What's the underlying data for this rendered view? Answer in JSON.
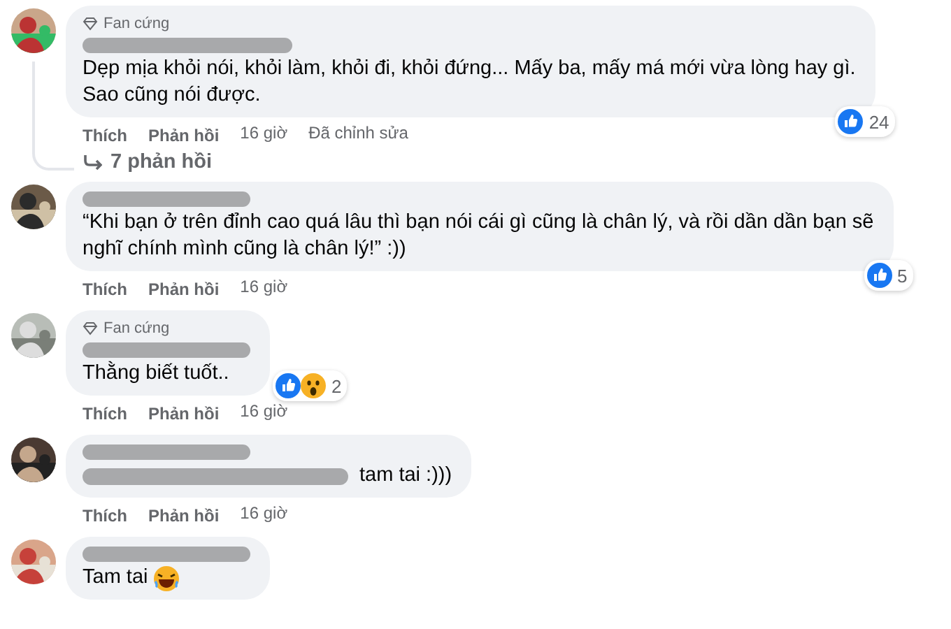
{
  "comments": [
    {
      "kind": "plain",
      "badge": "Fan cứng",
      "text": [
        "Dẹp mịa khỏi nói, khỏi làm, khỏi đi, khỏi đứng... Mấy ba, mấy má mới vừa lòng hay gì.",
        "Sao cũng nói được."
      ],
      "reactions": [
        {
          "kind": "like"
        }
      ],
      "reaction_count": "24",
      "actions": [
        "Thích",
        "Phản hồi",
        "16 giờ",
        "Đã chỉnh sửa"
      ],
      "replies": "7 phản hồi"
    },
    {
      "kind": "plain",
      "text": [
        "“Khi bạn ở trên đỉnh cao quá lâu thì bạn nói cái gì cũng là chân lý, và rồi dần dần bạn sẽ",
        "nghĩ chính mình cũng là chân lý!” :))"
      ],
      "reactions": [
        {
          "kind": "like"
        }
      ],
      "reaction_count": "5",
      "actions": [
        "Thích",
        "Phản hồi",
        "16 giờ"
      ]
    },
    {
      "kind": "plain",
      "badge": "Fan cứng",
      "text": [
        "Thằng biết tuốt.."
      ],
      "reactions": [
        {
          "kind": "like"
        },
        {
          "kind": "wow"
        }
      ],
      "reaction_count": "2",
      "actions": [
        "Thích",
        "Phản hồi",
        "16 giờ"
      ]
    },
    {
      "kind": "mention",
      "text": [
        "tam tai :)))"
      ],
      "actions": [
        "Thích",
        "Phản hồi",
        "16 giờ"
      ]
    },
    {
      "kind": "emoji",
      "text": [
        "Tam tai"
      ]
    }
  ]
}
